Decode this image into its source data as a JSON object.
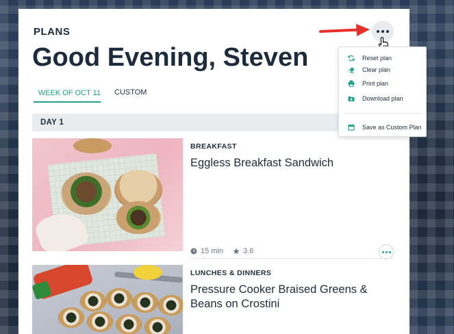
{
  "page": {
    "section_label": "PLANS",
    "greeting": "Good Evening, Steven"
  },
  "tabs": [
    {
      "label": "WEEK OF OCT 11",
      "icon": "calendar-icon",
      "active": true
    },
    {
      "label": "CUSTOM",
      "active": false
    }
  ],
  "day": {
    "label": "DAY 1"
  },
  "meals": [
    {
      "category": "BREAKFAST",
      "title": "Eggless Breakfast Sandwich",
      "time": "15 min",
      "rating": "3.6"
    },
    {
      "category": "LUNCHES & DINNERS",
      "title": "Pressure Cooker Braised Greens & Beans on Crostini"
    }
  ],
  "options_menu": {
    "items": [
      {
        "label": "Reset plan",
        "icon": "refresh-icon"
      },
      {
        "label": "Clear plan",
        "icon": "eraser-icon"
      },
      {
        "label": "Print plan",
        "icon": "printer-icon"
      },
      {
        "label": "Download plan",
        "icon": "download-folder-icon"
      }
    ],
    "footer_item": {
      "label": "Save as Custom Plan",
      "icon": "calendar-save-icon"
    }
  },
  "colors": {
    "accent": "#1fa089",
    "text": "#1d2c3c",
    "arrow": "#e8302a"
  }
}
